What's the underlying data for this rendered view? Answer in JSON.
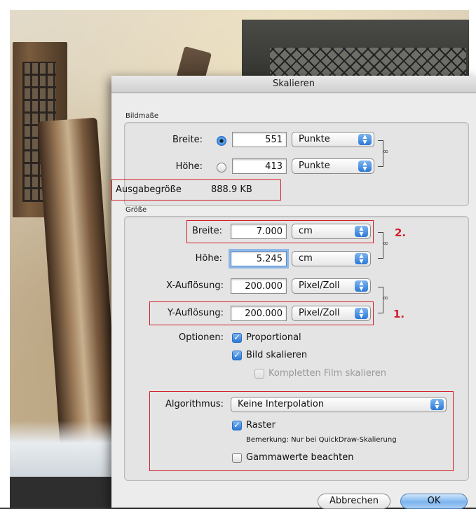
{
  "dialog": {
    "title": "Skalieren",
    "bildmasse": {
      "section_label": "Bildmaße",
      "breite_label": "Breite:",
      "breite_value": "551",
      "breite_unit": "Punkte",
      "hoehe_label": "Höhe:",
      "hoehe_value": "413",
      "hoehe_unit": "Punkte",
      "selected_radio": "breite"
    },
    "output": {
      "label": "Ausgabegröße",
      "value": "888.9 KB"
    },
    "groesse": {
      "section_label": "Größe",
      "breite_label": "Breite:",
      "breite_value": "7.000",
      "breite_unit": "cm",
      "hoehe_label": "Höhe:",
      "hoehe_value": "5.245",
      "hoehe_unit": "cm",
      "x_label": "X-Auflösung:",
      "x_value": "200.000",
      "x_unit": "Pixel/Zoll",
      "y_label": "Y-Auflösung:",
      "y_value": "200.000",
      "y_unit": "Pixel/Zoll",
      "options_label": "Optionen:",
      "opt_proportional": "Proportional",
      "opt_bild_skalieren": "Bild skalieren",
      "opt_film": "Kompletten Film skalieren",
      "algorithm_label": "Algorithmus:",
      "algorithm_value": "Keine Interpolation",
      "raster_label": "Raster",
      "remark": "Bemerkung: Nur bei QuickDraw-Skalierung",
      "gamma_label": "Gammawerte beachten"
    },
    "buttons": {
      "cancel": "Abbrechen",
      "ok": "OK"
    }
  },
  "annotations": {
    "marker_2": "2.",
    "marker_1": "1."
  },
  "colors": {
    "annotation_red": "#d21f2b",
    "accent_blue": "#2a78d6"
  }
}
